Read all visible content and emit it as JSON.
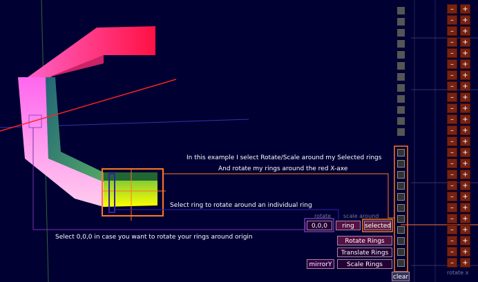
{
  "annotations": {
    "line1": "In this example I select Rotate/Scale around my Selected rings",
    "line2": "And rotate my rings around the red X-axe",
    "select_ring": "Select ring to rotate around an individual ring",
    "select_origin": "Select 0,0,0 in case you want to rotate your rings around origin"
  },
  "controls": {
    "rotate_group_label": "rotate",
    "scale_group_label": "scale around",
    "origin_button": "0,0,0",
    "ring_button": "ring",
    "selected_button": "selected",
    "rotate_rings": "Rotate Rings",
    "translate_rings": "Translate Rings",
    "scale_rings": "Scale Rings",
    "mirror_y": "mirrorY",
    "clear": "clear"
  },
  "side_panel": {
    "minus": "–",
    "plus": "+",
    "label": "rotate x"
  },
  "colors": {
    "background": "#000033",
    "highlight": "#ff7722",
    "selection": "#7733aa",
    "axis_red": "#ff2222",
    "stepper_bg": "#772211"
  }
}
